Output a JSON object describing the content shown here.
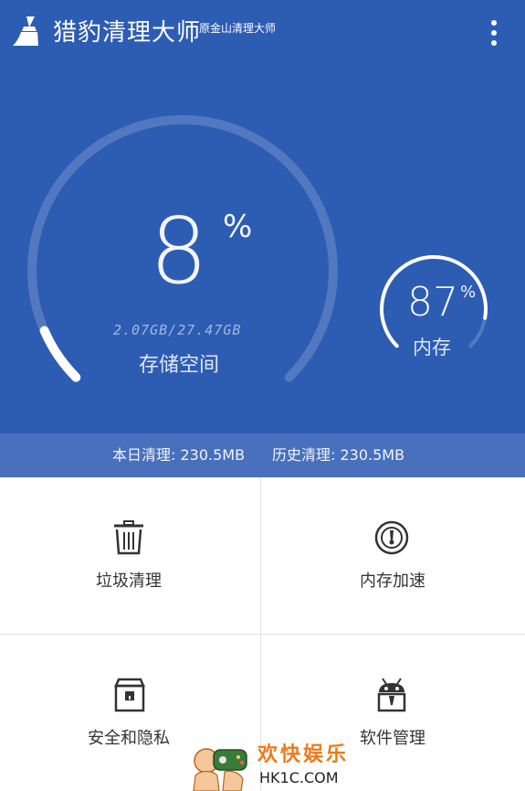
{
  "header": {
    "app_title": "猎豹清理大师",
    "subtitle": "原金山清理大师",
    "more_icon": "more-vert-icon",
    "logo_icon": "broom-icon"
  },
  "storage": {
    "percent": "8",
    "percent_sign": "%",
    "usage": "2.07GB/27.47GB",
    "label": "存储空间",
    "fill_fraction": 0.08
  },
  "memory": {
    "percent": "87",
    "percent_sign": "%",
    "label": "内存",
    "fill_fraction": 0.87
  },
  "stats": {
    "today": "本日清理: 230.5MB",
    "history": "历史清理: 230.5MB"
  },
  "tools": [
    {
      "label": "垃圾清理",
      "icon": "trash-icon"
    },
    {
      "label": "内存加速",
      "icon": "speedometer-icon"
    },
    {
      "label": "安全和隐私",
      "icon": "lockbox-icon"
    },
    {
      "label": "软件管理",
      "icon": "android-icon"
    }
  ],
  "watermark": {
    "text": "欢快娱乐",
    "url": "HK1C.COM"
  },
  "colors": {
    "primary": "#2d5cb3",
    "stats_bar": "#4870bd",
    "watermark": "#ee7a18"
  }
}
